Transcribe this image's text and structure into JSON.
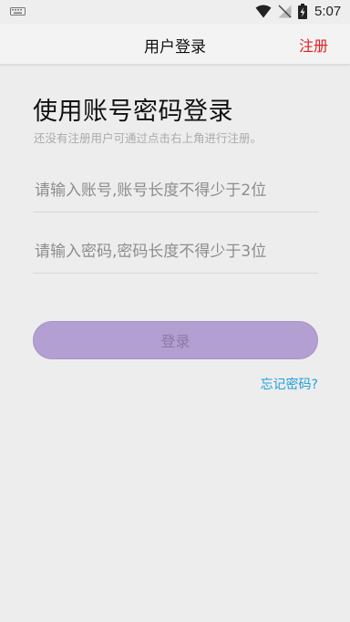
{
  "status_bar": {
    "time": "5:07",
    "icons": [
      "keyboard-icon",
      "wifi-icon",
      "no-signal-icon",
      "battery-charging-icon"
    ]
  },
  "app_bar": {
    "title": "用户登录",
    "register_label": "注册"
  },
  "main": {
    "heading": "使用账号密码登录",
    "subheading": "还没有注册用户可通过点击右上角进行注册。",
    "account_placeholder": "请输入账号,账号长度不得少于2位",
    "account_value": "",
    "password_placeholder": "请输入密码,密码长度不得少于3位",
    "password_value": "",
    "login_label": "登录",
    "forgot_label": "忘记密码?"
  },
  "colors": {
    "accent_red": "#e0201f",
    "login_button": "#b39fd2",
    "link_blue": "#1fa0e0"
  }
}
